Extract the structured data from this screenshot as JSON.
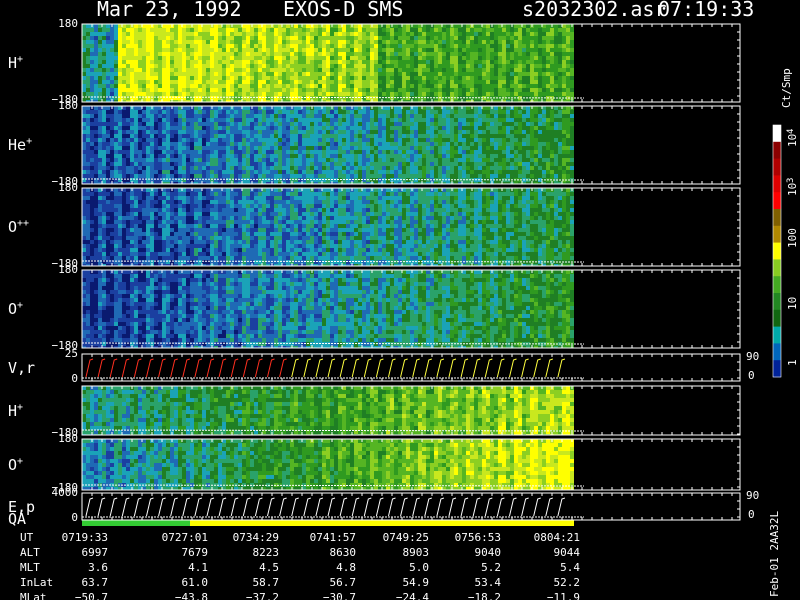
{
  "header": {
    "date": "Mar 23, 1992",
    "instrument": "EXOS-D SMS",
    "filename": "s2032302.asr",
    "time": "07:19:33"
  },
  "colorbar": {
    "unit": "Ct/Smp",
    "labels": [
      "10",
      "4",
      "10",
      "3",
      "100",
      "10",
      "1"
    ],
    "colors": [
      "#ffffff",
      "#8b0000",
      "#b00000",
      "#dd0000",
      "#ff0000",
      "#806000",
      "#b08800",
      "#ffff00",
      "#88cc22",
      "#44aa22",
      "#228822",
      "#116611",
      "#00aaaa",
      "#0066bb",
      "#002299"
    ]
  },
  "colors": {
    "background": "#000000",
    "axis": "#ffffff",
    "trace_red": "#ff3020",
    "trace_yellow": "#ffff40",
    "qa_green": "#33cc33",
    "qa_yellow": "#ffff00"
  },
  "chart_data": {
    "type": "heatmap",
    "panels": [
      {
        "species": "H",
        "charge": "+",
        "ymax": "180",
        "ymin": "−180",
        "start": 0.55,
        "end": 0.8
      },
      {
        "species": "He",
        "charge": "+",
        "ymax": "180",
        "ymin": "−180",
        "start": 0.15,
        "end": 0.52
      },
      {
        "species": "O",
        "charge": "++",
        "ymax": "180",
        "ymin": "−180",
        "start": 0.12,
        "end": 0.5
      },
      {
        "species": "O",
        "charge": "+",
        "ymax": "180",
        "ymin": "−180",
        "start": 0.1,
        "end": 0.55
      },
      {
        "species": "V,r",
        "charge": "",
        "ymax": "25",
        "ymin": "0",
        "rmax": "90",
        "rmin": "0"
      },
      {
        "species": "H",
        "charge": "+",
        "ymax": "",
        "ymin": "−180",
        "start": 0.35,
        "end": 0.85
      },
      {
        "species": "O",
        "charge": "+",
        "ymax": "180",
        "ymin": "−180",
        "start": 0.25,
        "end": 0.95
      },
      {
        "species": "E,p",
        "charge": "",
        "ymax": "4000",
        "ymin": "0",
        "rmax": "90",
        "rmin": "0",
        "sublabel": "QA"
      }
    ],
    "orbit_table": {
      "rows": [
        {
          "label": "UT",
          "values": [
            "0719:33",
            "0727:01",
            "0734:29",
            "0741:57",
            "0749:25",
            "0756:53",
            "0804:21"
          ]
        },
        {
          "label": "ALT",
          "values": [
            "6997",
            "7679",
            "8223",
            "8630",
            "8903",
            "9040",
            "9044"
          ]
        },
        {
          "label": "MLT",
          "values": [
            "3.6",
            "4.1",
            "4.5",
            "4.8",
            "5.0",
            "5.2",
            "5.4"
          ]
        },
        {
          "label": "InLat",
          "values": [
            "63.7",
            "61.0",
            "58.7",
            "56.7",
            "54.9",
            "53.4",
            "52.2"
          ]
        },
        {
          "label": "MLat",
          "values": [
            "−50.7",
            "−43.8",
            "−37.2",
            "−30.7",
            "−24.4",
            "−18.2",
            "−11.9"
          ]
        }
      ]
    }
  },
  "footer": {
    "version": "Feb-01 2AA32L"
  }
}
